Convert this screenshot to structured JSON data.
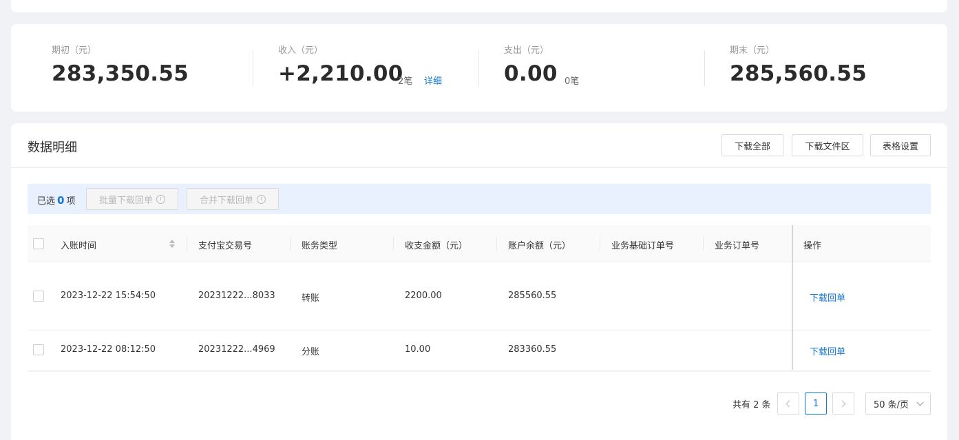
{
  "summary": {
    "opening": {
      "label": "期初（元）",
      "value": "283,350.55"
    },
    "income": {
      "label": "收入（元）",
      "value": "+2,210.00",
      "count": "2笔",
      "detail_link": "详细"
    },
    "expense": {
      "label": "支出（元）",
      "value": "0.00",
      "count": "0笔"
    },
    "closing": {
      "label": "期末（元）",
      "value": "285,560.55"
    }
  },
  "main": {
    "title": "数据明细",
    "buttons": {
      "download_all": "下载全部",
      "download_files": "下载文件区",
      "table_settings": "表格设置"
    }
  },
  "selection": {
    "prefix": "已选",
    "count": "0",
    "suffix": "项",
    "batch_download": "批量下载回单",
    "merge_download": "合并下载回单"
  },
  "table": {
    "columns": [
      "入账时间",
      "支付宝交易号",
      "账务类型",
      "收支金额（元）",
      "账户余额（元）",
      "业务基础订单号",
      "业务订单号",
      "操作"
    ],
    "rows": [
      {
        "time": "2023-12-22 15:54:50",
        "trade_no": "20231222...8033",
        "type": "转账",
        "amount": "2200.00",
        "balance": "285560.55",
        "base_order": "",
        "order": "",
        "action": "下载回单"
      },
      {
        "time": "2023-12-22 08:12:50",
        "trade_no": "20231222...4969",
        "type": "分账",
        "amount": "10.00",
        "balance": "283360.55",
        "base_order": "",
        "order": "",
        "action": "下载回单"
      }
    ]
  },
  "pagination": {
    "total": "共有 2 条",
    "current_page": "1",
    "page_size": "50 条/页"
  },
  "colors": {
    "link": "#1677d4",
    "selection_bar": "#e8f1fd",
    "background": "#f0f2f5"
  }
}
